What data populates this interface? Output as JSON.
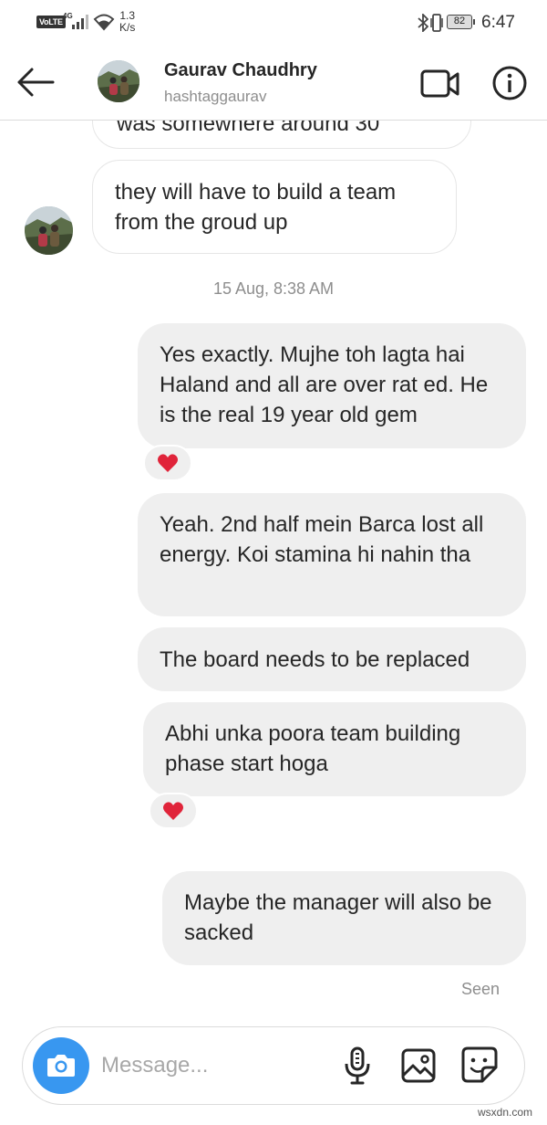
{
  "status_bar": {
    "network_badge": "VoLTE",
    "network_type": "4G",
    "speed_value": "1.3",
    "speed_unit": "K/s",
    "battery": "82",
    "time": "6:47"
  },
  "header": {
    "name": "Gaurav Chaudhry",
    "username": "hashtaggaurav"
  },
  "messages": {
    "partial_text": "was somewhere around 30",
    "incoming_1": "they will have to build a team from the groud up",
    "timestamp": "15 Aug, 8:38 AM",
    "outgoing_1": "Yes exactly. Mujhe toh lagta hai Haland and all are over rat ed. He is the real 19 year old gem",
    "outgoing_2": "Yeah. 2nd half mein Barca lost all energy. Koi stamina hi nahin tha",
    "outgoing_3": "The board needs to be replaced",
    "outgoing_4": "Abhi unka poora team building phase start hoga",
    "outgoing_5": "Maybe the manager will also be sacked",
    "seen": "Seen"
  },
  "reactions": [
    "❤️",
    "❤️"
  ],
  "composer": {
    "placeholder": "Message..."
  },
  "watermark": "wsxdn.com",
  "colors": {
    "accent": "#3897f0",
    "heart": "#e0243a",
    "bubble_out": "#efefef",
    "secondary_text": "#8e8e8e"
  },
  "icons": [
    "back-arrow-icon",
    "video-call-icon",
    "info-icon",
    "camera-icon",
    "microphone-icon",
    "gallery-icon",
    "sticker-icon",
    "heart-icon"
  ]
}
